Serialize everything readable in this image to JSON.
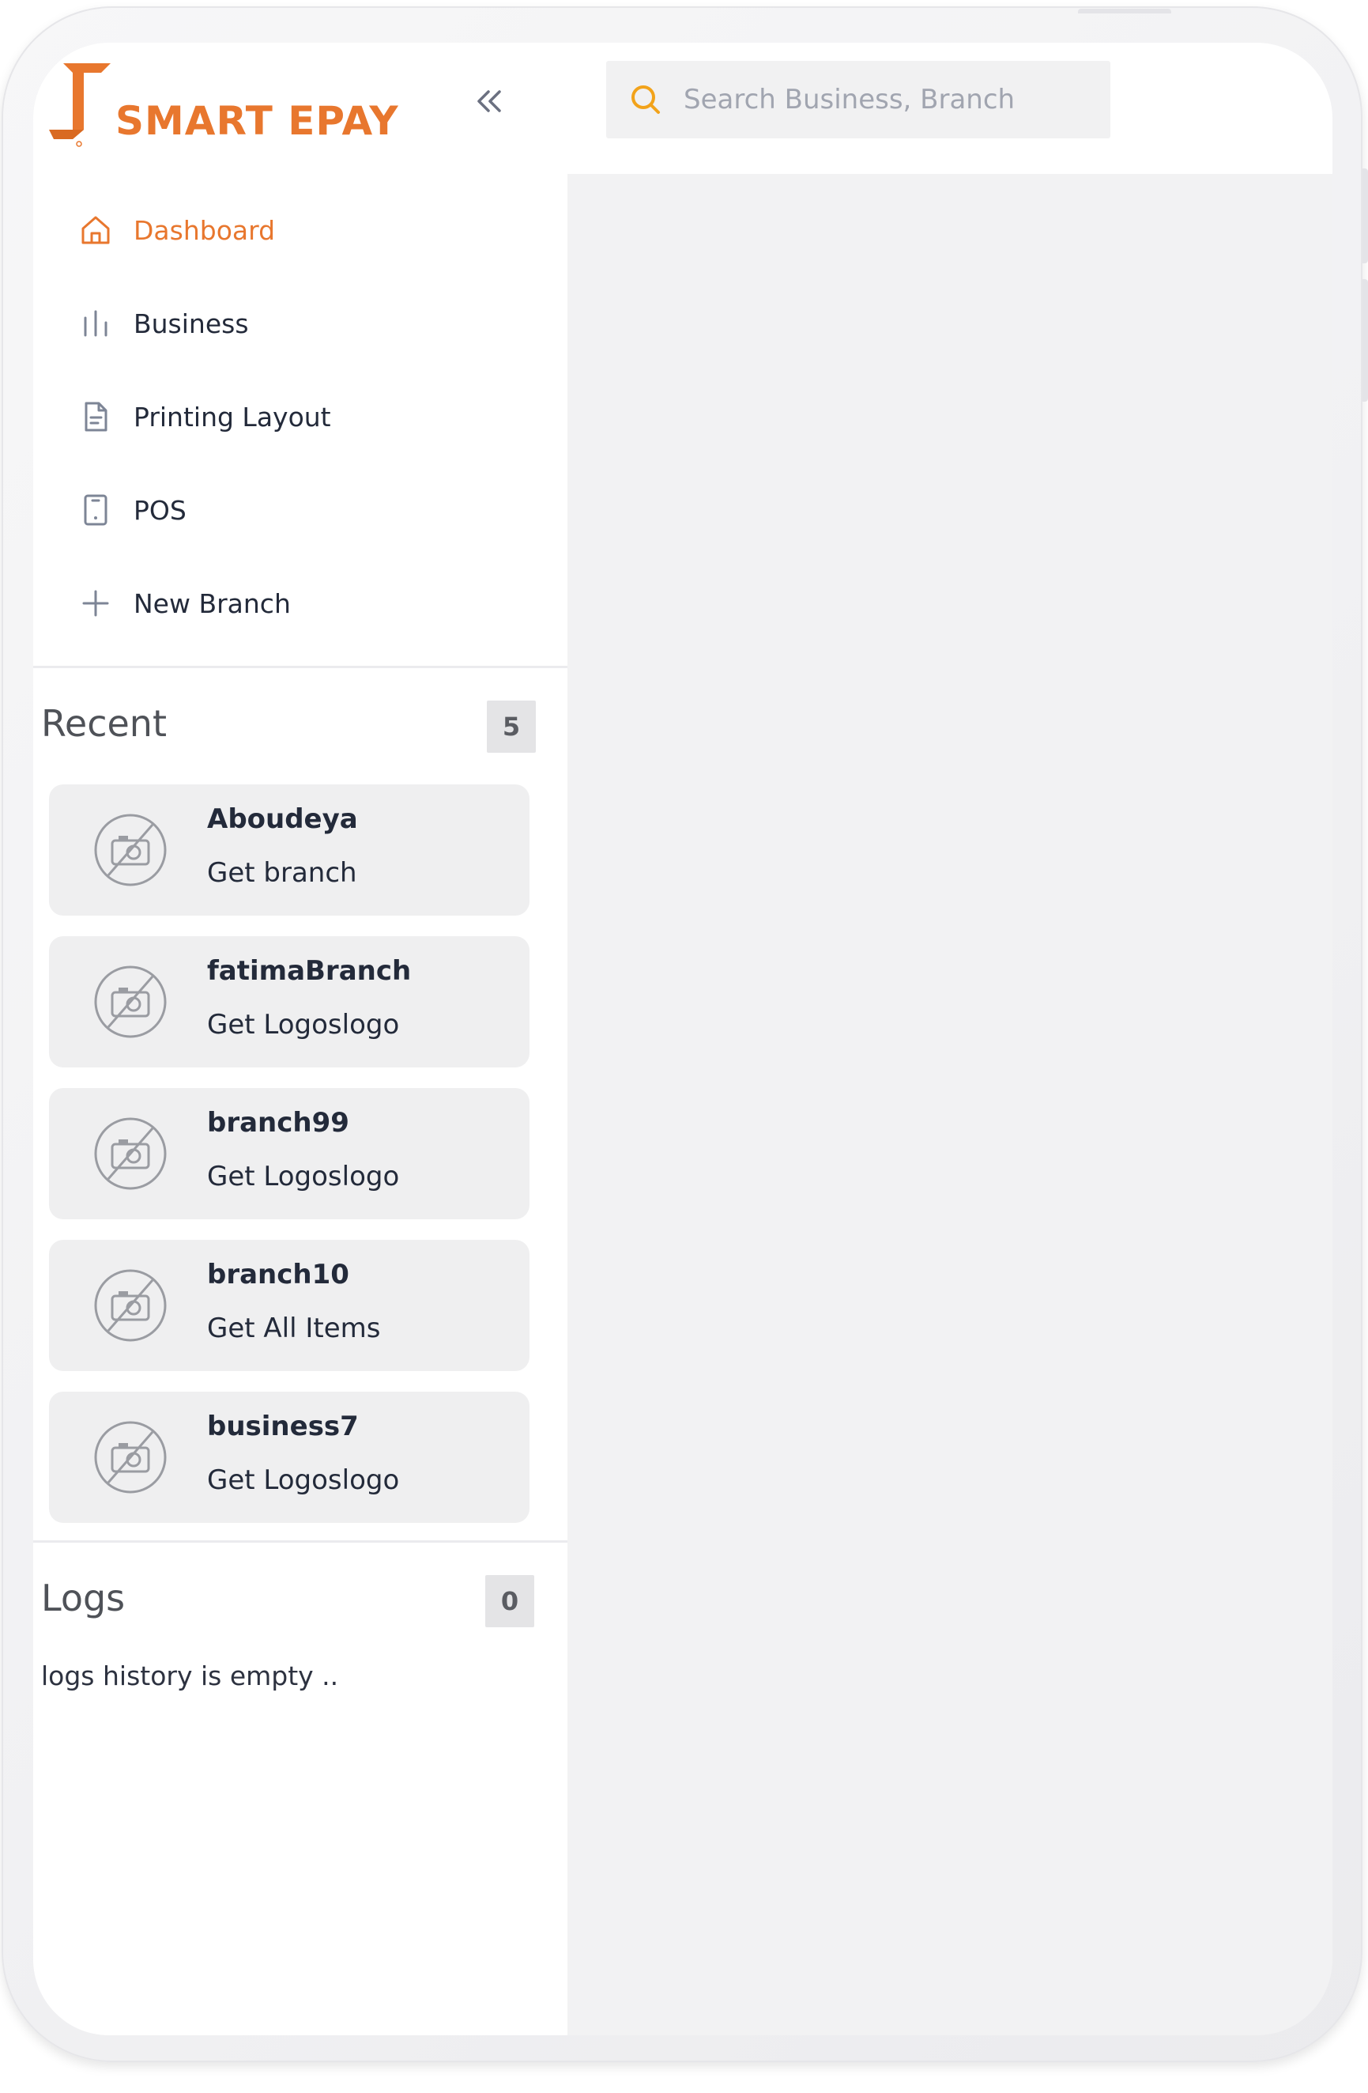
{
  "brand": {
    "name": "SMART EPAY",
    "accent_color": "#e8772e"
  },
  "search": {
    "placeholder": "Search Business, Branch",
    "icon": "search-icon",
    "icon_color": "#f2a31b"
  },
  "sidebar": {
    "collapse_icon": "double-chevron-left-icon",
    "nav": [
      {
        "label": "Dashboard",
        "icon": "home-icon",
        "active": true
      },
      {
        "label": "Business",
        "icon": "bar-chart-icon",
        "active": false
      },
      {
        "label": "Printing Layout",
        "icon": "document-icon",
        "active": false
      },
      {
        "label": "POS",
        "icon": "tablet-icon",
        "active": false
      },
      {
        "label": "New Branch",
        "icon": "plus-icon",
        "active": false
      }
    ]
  },
  "recent": {
    "title": "Recent",
    "count": "5",
    "items": [
      {
        "title": "Aboudeya",
        "subtitle": "Get branch",
        "thumb_icon": "no-image-icon"
      },
      {
        "title": "fatimaBranch",
        "subtitle": "Get Logoslogo",
        "thumb_icon": "no-image-icon"
      },
      {
        "title": "branch99",
        "subtitle": "Get Logoslogo",
        "thumb_icon": "no-image-icon"
      },
      {
        "title": "branch10",
        "subtitle": "Get All Items",
        "thumb_icon": "no-image-icon"
      },
      {
        "title": "business7",
        "subtitle": "Get Logoslogo",
        "thumb_icon": "no-image-icon"
      }
    ]
  },
  "logs": {
    "title": "Logs",
    "count": "0",
    "empty_message": "logs history is empty .."
  }
}
